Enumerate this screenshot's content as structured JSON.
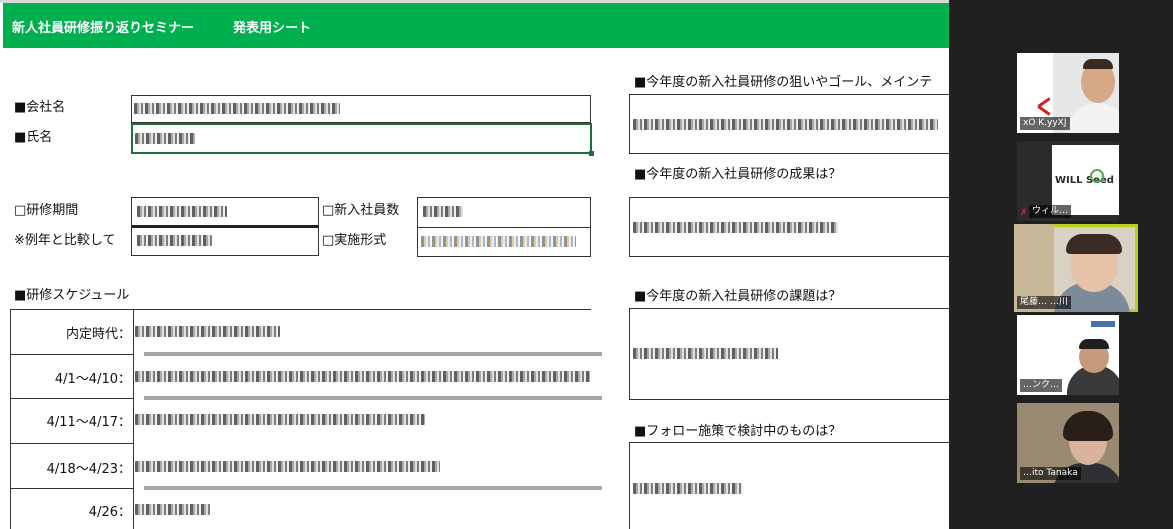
{
  "banner": {
    "title": "新人社員研修振り返りセミナー",
    "subtitle": "発表用シート"
  },
  "form": {
    "company_label": "■会社名",
    "name_label": "■氏名",
    "period_label": "□研修期間",
    "compare_label": "※例年と比較して",
    "new_employees_label": "□新入社員数",
    "format_label": "□実施形式",
    "schedule_label": "■研修スケジュール"
  },
  "schedule": {
    "rows": [
      {
        "date": "内定時代："
      },
      {
        "date": "4/1～4/10："
      },
      {
        "date": "4/11～4/17："
      },
      {
        "date": "4/18～4/23："
      },
      {
        "date": "4/26："
      }
    ]
  },
  "questions": {
    "q1": "■今年度の新入社員研修の狙いやゴール、メインテ",
    "q2": "■今年度の新入社員研修の成果は？",
    "q3": "■今年度の新入社員研修の課題は？",
    "q4": "■フォロー施策で検討中のものは？"
  },
  "participants": [
    {
      "name": "xO K.yyXJ"
    },
    {
      "name": "ウィル…"
    },
    {
      "name": "尾藤… …川"
    },
    {
      "name": "…ンク…"
    },
    {
      "name": "…ito Tanaka"
    }
  ],
  "participant2_logo": "WILL Seed",
  "colors": {
    "banner": "#00b04f",
    "active_speaker": "#b5d11c",
    "selection": "#1e6f3f"
  }
}
